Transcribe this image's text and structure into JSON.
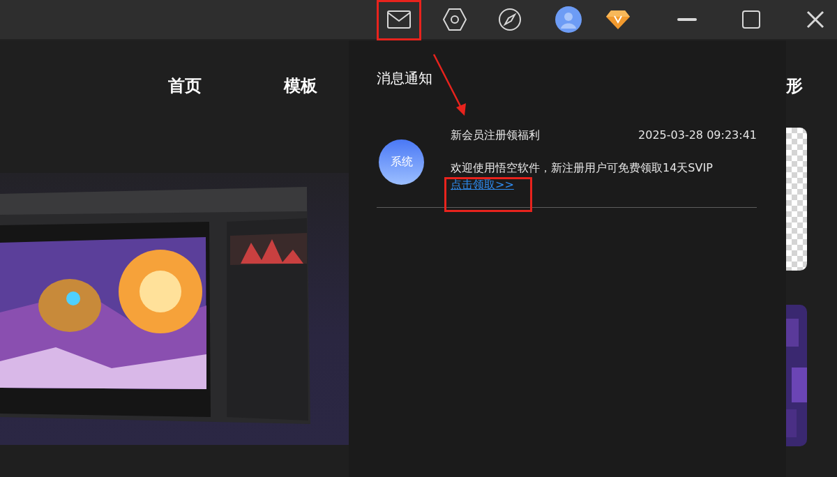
{
  "nav": [
    "首页",
    "模板",
    "形"
  ],
  "notification_panel": {
    "title": "消息通知",
    "messages": [
      {
        "avatar": "系统",
        "title": "新会员注册领福利",
        "time": "2025-03-28 09:23:41",
        "body": "欢迎使用悟空软件，新注册用户可免费领取14天SVIP",
        "link": "点击领取>>"
      }
    ]
  }
}
